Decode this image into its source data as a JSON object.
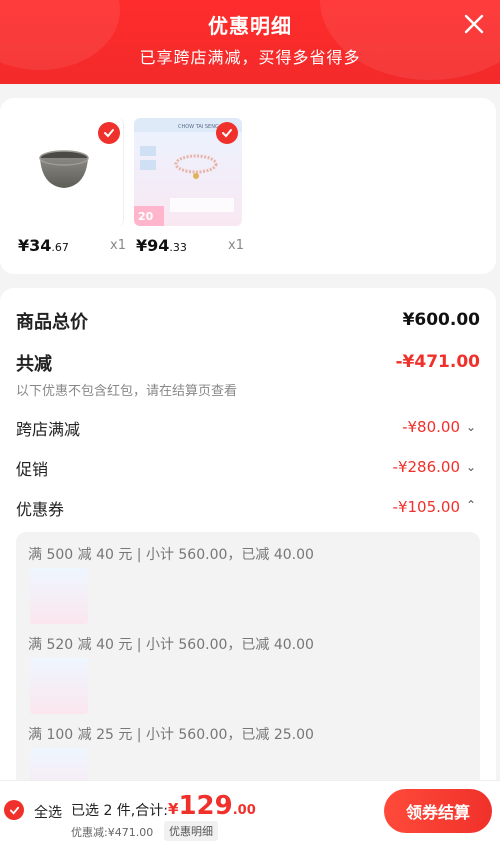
{
  "header": {
    "title": "优惠明细",
    "subtitle": "已享跨店满减，买得多省得多"
  },
  "products": [
    {
      "price_int": "¥34",
      "price_dec": ".67",
      "qty": "x1",
      "image": "steel-bowl"
    },
    {
      "price_int": "¥94",
      "price_dec": ".33",
      "qty": "x1",
      "image": "bracelet-promo"
    }
  ],
  "product2_text": {
    "brand": "CHOW TAI SENG",
    "badge": "20"
  },
  "summary": {
    "total_label": "商品总价",
    "total_value": "¥600.00",
    "reduce_label": "共减",
    "reduce_value": "-¥471.00",
    "note": "以下优惠不包含红包，请在结算页查看",
    "items": [
      {
        "label": "跨店满减",
        "value": "-¥80.00",
        "chevron": "chevron-down"
      },
      {
        "label": "促销",
        "value": "-¥286.00",
        "chevron": "chevron-down"
      },
      {
        "label": "优惠券",
        "value": "-¥105.00",
        "chevron": "chevron-up"
      }
    ]
  },
  "coupons": [
    {
      "text": "满 500 减 40 元 | 小计 560.00，已减 40.00"
    },
    {
      "text": "满 520 减 40 元 | 小计 560.00，已减 40.00"
    },
    {
      "text": "满 100 减 25 元 | 小计 560.00，已减 25.00"
    }
  ],
  "footer": {
    "select_all": "全选",
    "selected_info": "已选 2 件,合计:",
    "total_currency": "¥",
    "total_int": "129",
    "total_dec": ".00",
    "saved": "优惠减:¥471.00",
    "detail_tag": "优惠明细",
    "pay_button": "领券结算"
  },
  "colors": {
    "accent": "#f0312b",
    "header": "#ff2c2c"
  }
}
